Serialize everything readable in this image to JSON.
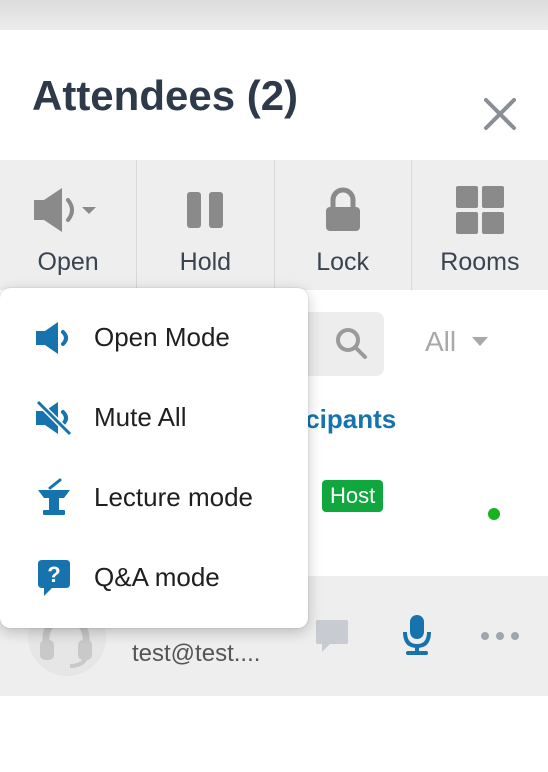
{
  "header": {
    "title": "Attendees (2)",
    "close_icon": "close-icon"
  },
  "toolbar": {
    "items": [
      {
        "label": "Open",
        "icon": "speaker-dropdown-icon"
      },
      {
        "label": "Hold",
        "icon": "pause-icon"
      },
      {
        "label": "Lock",
        "icon": "lock-icon"
      },
      {
        "label": "Rooms",
        "icon": "grid-icon"
      }
    ]
  },
  "filter": {
    "search_icon": "search-icon",
    "selected": "All"
  },
  "participants": {
    "link_text": "icipants",
    "host_row_partial": ")",
    "host_badge": "Host",
    "status_color": "#17b21f"
  },
  "attendee": {
    "email": "test@test....",
    "avatar_icon": "headset-icon"
  },
  "audio_mode_menu": {
    "items": [
      {
        "label": "Open Mode",
        "icon": "speaker-open-icon"
      },
      {
        "label": "Mute All",
        "icon": "speaker-muted-icon"
      },
      {
        "label": "Lecture mode",
        "icon": "lectern-icon"
      },
      {
        "label": "Q&A mode",
        "icon": "question-bubble-icon"
      }
    ]
  },
  "colors": {
    "accent_blue": "#1673ad",
    "host_green": "#11a73f",
    "icon_gray": "#8a8a8a"
  }
}
